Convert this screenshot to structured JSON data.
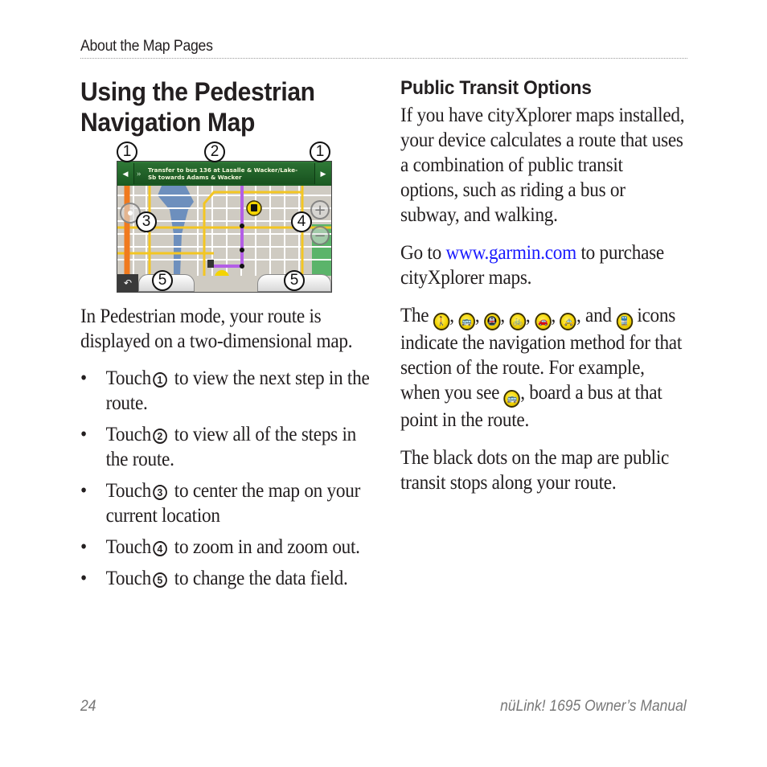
{
  "header": {
    "running_head": "About the Map Pages"
  },
  "left": {
    "title_line1": "Using the Pedestrian",
    "title_line2": "Navigation Map",
    "figure": {
      "banner_instruction_line1": "Transfer to bus 136 at Lasalle & Wacker/Lake-",
      "banner_instruction_line2": "Sb towards Adams & Wacker",
      "prev_arrow": "◀",
      "next_arrow": "▶",
      "turn_icon": "»",
      "back_icon": "↶",
      "zoom_in": "+",
      "zoom_out": "−",
      "callouts": [
        "1",
        "2",
        "1",
        "3",
        "4",
        "5",
        "5"
      ],
      "colors": {
        "banner_green": "#1f6327",
        "map_bg": "#cfcbc2",
        "road_yellow": "#f3c623",
        "water_blue": "#6d8fbd",
        "route_purple": "#b35ee6",
        "highway_orange": "#f07a1e",
        "park_green": "#5bb46a"
      }
    },
    "intro": "In Pedestrian mode, your route is displayed on a two-dimensional map.",
    "bullets": [
      {
        "pre": "Touch",
        "num": "1",
        "post": "to view the next step in the route."
      },
      {
        "pre": "Touch",
        "num": "2",
        "post": "to view all of the steps in the route."
      },
      {
        "pre": "Touch",
        "num": "3",
        "post": "to center the map on your current location"
      },
      {
        "pre": "Touch",
        "num": "4",
        "post": "to zoom in and zoom out."
      },
      {
        "pre": "Touch",
        "num": "5",
        "post": "to change the data field."
      }
    ],
    "bullet_char": "•"
  },
  "right": {
    "heading": "Public Transit Options",
    "p1": "If you have cityXplorer maps installed, your device calculates a route that uses a combination of public transit options, such as riding a bus or subway, and walking.",
    "p2_pre": "Go to ",
    "p2_link": "www.garmin.com",
    "p2_post": " to purchase cityXplorer maps.",
    "p3_pre": "The",
    "p3_and": ", and",
    "p3_post": "icons indicate the navigation method for that section of the route. For example, when you see",
    "p3_post2": ", board a bus at that point in the route.",
    "transit_icons": [
      {
        "name": "walking-icon",
        "glyph": "🚶"
      },
      {
        "name": "bus-icon",
        "glyph": "🚌"
      },
      {
        "name": "subway-icon",
        "glyph": "🚇"
      },
      {
        "name": "bicycle-icon",
        "glyph": "🚲"
      },
      {
        "name": "car-icon",
        "glyph": "🚗"
      },
      {
        "name": "taxi-icon",
        "glyph": "🚕"
      },
      {
        "name": "train-icon",
        "glyph": "🚆"
      }
    ],
    "p4": "The black dots on the map are public transit stops along your route.",
    "link_color": "#1a1aff",
    "icon_color": "#f4d400"
  },
  "footer": {
    "page_number": "24",
    "manual_title": "nüLink! 1695 Owner’s Manual"
  }
}
